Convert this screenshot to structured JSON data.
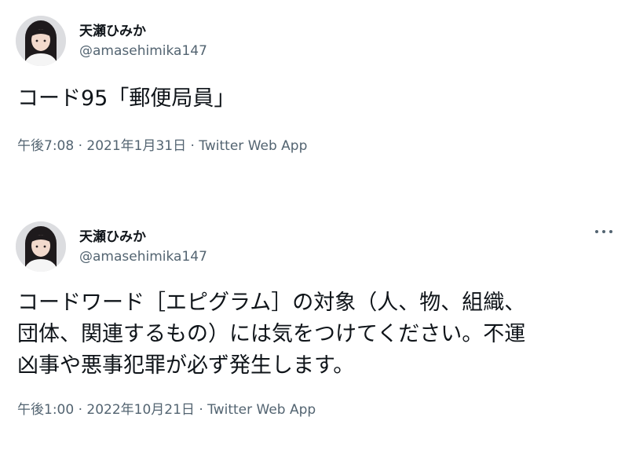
{
  "tweets": [
    {
      "author": {
        "display_name": "天瀬ひみか",
        "handle": "@amasehimika147",
        "avatar_icon": "avatar-photo"
      },
      "text_lines": [
        "コード95「郵便局員」"
      ],
      "meta": "午後7:08 · 2021年1月31日 · Twitter Web App",
      "more_menu": false
    },
    {
      "author": {
        "display_name": "天瀬ひみか",
        "handle": "@amasehimika147",
        "avatar_icon": "avatar-photo"
      },
      "text_lines": [
        "コードワード［エピグラム］の対象（人、物、組織、",
        "団体、関連するもの）には気をつけてください。不運",
        "凶事や悪事犯罪が必ず発生します。"
      ],
      "meta": "午後1:00 · 2022年10月21日 · Twitter Web App",
      "more_menu": true,
      "more_icon": "more-horizontal-icon"
    }
  ],
  "colors": {
    "text_primary": "#0f1419",
    "text_secondary": "#536471",
    "background": "#ffffff"
  }
}
